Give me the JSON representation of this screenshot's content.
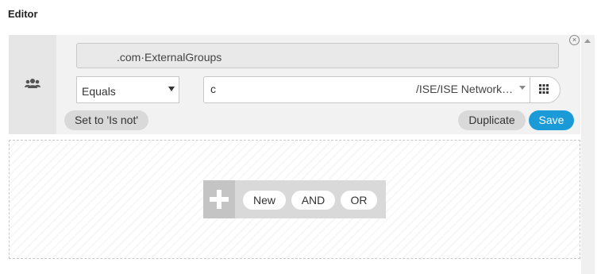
{
  "editor": {
    "title": "Editor"
  },
  "condition": {
    "attribute": ".com·ExternalGroups",
    "operator": {
      "selected": "Equals"
    },
    "value": {
      "prefix": "c",
      "path": "/ISE/ISE Network…"
    },
    "buttons": {
      "is_not": "Set to 'Is not'",
      "duplicate": "Duplicate",
      "save": "Save"
    }
  },
  "add_bar": {
    "new": "New",
    "and": "AND",
    "or": "OR"
  },
  "icons": {
    "group": "users-group-icon",
    "grid": "grid-icon",
    "close": "close-circle-icon",
    "plus": "plus-icon"
  },
  "colors": {
    "save_button": "#1a9bd7",
    "panel_bg": "#f2f2f2",
    "pill_bg": "#d9d9d9"
  }
}
